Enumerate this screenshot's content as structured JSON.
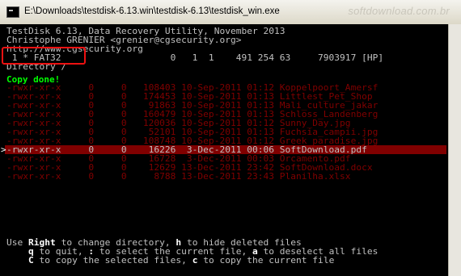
{
  "window": {
    "title": "E:\\Downloads\\testdisk-6.13.win\\testdisk-6.13\\testdisk_win.exe",
    "watermark": "softdownload.com.br"
  },
  "console": {
    "header": [
      "TestDisk 6.13, Data Recovery Utility, November 2013",
      "Christophe GRENIER <grenier@cgsecurity.org>",
      "http://www.cgsecurity.org",
      " 1 * FAT32                    0   1  1    491 254 63     7903917 [HP]",
      "Directory /"
    ],
    "status": "Copy done!",
    "files": [
      "-rwxr-xr-x     0     0   108403 10-Sep-2011 01:12 Koppelpoort_Amersf",
      "-rwxr-xr-x     0     0   174453 10-Sep-2011 01:13 Littlest_Pet_Shop",
      "-rwxr-xr-x     0     0    91863 10-Sep-2011 01:13 Mali_culture_jakar",
      "-rwxr-xr-x     0     0   160479 10-Sep-2011 01:13 Schloss_Landenberg",
      "-rwxr-xr-x     0     0   120036 10-Sep-2011 01:12 Sunny_Day.jpg",
      "-rwxr-xr-x     0     0    52101 10-Sep-2011 01:13 Fuchsia_campii.jpg",
      "-rwxr-xr-x     0     0   108748 10-Sep-2011 01:12 Greek_paradise.jpg",
      "-rwxr-xr-x     0     0    16226  3-Dec-2011 00:06 SoftDownload.pdf",
      "-rwxr-xr-x     0     0    16728  3-Dec-2011 00:03 Orcamento.pdf",
      "-rwxr-xr-x     0     0    12629 13-Dec-2011 23:42 SoftDownload.docx",
      "-rwxr-xr-x     0     0     8788 13-Dec-2011 23:43 Planilha.xlsx"
    ],
    "selected_marker": ">",
    "help": {
      "l1_use": "Use ",
      "l1_right": "Right",
      "l1_mid": " to change directory, ",
      "l1_h": "h",
      "l1_end": " to hide deleted files",
      "l2_pre": "    ",
      "l2_q": "q",
      "l2_mid1": " to quit, ",
      "l2_colon": ":",
      "l2_mid2": " to select the current file, ",
      "l2_a": "a",
      "l2_end": " to deselect all files",
      "l3_pre": "    ",
      "l3_C": "C",
      "l3_mid": " to copy the selected files, ",
      "l3_c": "c",
      "l3_end": " to copy the current file"
    }
  }
}
